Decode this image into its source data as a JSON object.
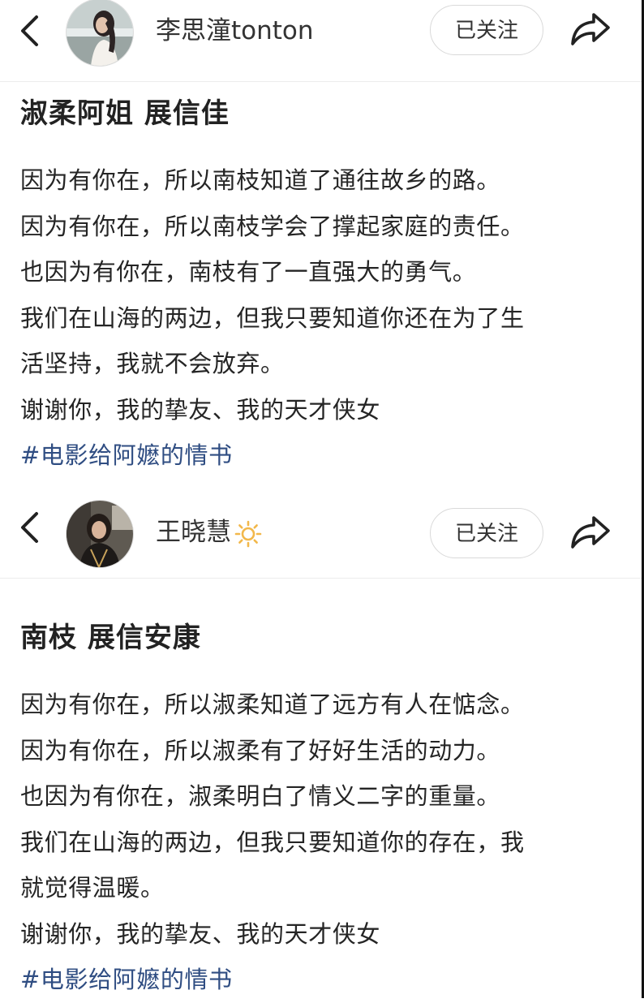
{
  "posts": [
    {
      "username": "李思潼tonton",
      "follow_label": "已关注",
      "title": "淑柔阿姐 展信佳",
      "lines": [
        "因为有你在，所以南枝知道了通往故乡的路。",
        "因为有你在，所以南枝学会了撑起家庭的责任。",
        "也因为有你在，南枝有了一直强大的勇气。",
        "我们在山海的两边，但我只要知道你还在为了生",
        "活坚持，我就不会放弃。",
        "谢谢你，我的挚友、我的天才侠女"
      ],
      "hashtag": "#电影给阿嬷的情书"
    },
    {
      "username": "王晓慧",
      "follow_label": "已关注",
      "title": "南枝 展信安康",
      "lines": [
        "因为有你在，所以淑柔知道了远方有人在惦念。",
        "因为有你在，所以淑柔有了好好生活的动力。",
        "也因为有你在，淑柔明白了情义二字的重量。",
        "我们在山海的两边，但我只要知道你的存在，我",
        "就觉得温暖。",
        "谢谢你，我的挚友、我的天才侠女"
      ],
      "hashtag": "#电影给阿嬷的情书"
    }
  ],
  "icons": {
    "back": "chevron-left-icon",
    "share": "share-arrow-icon",
    "username_badge": "sun-icon"
  },
  "colors": {
    "hashtag": "#2f4d82",
    "sun": "#f2b84b"
  }
}
